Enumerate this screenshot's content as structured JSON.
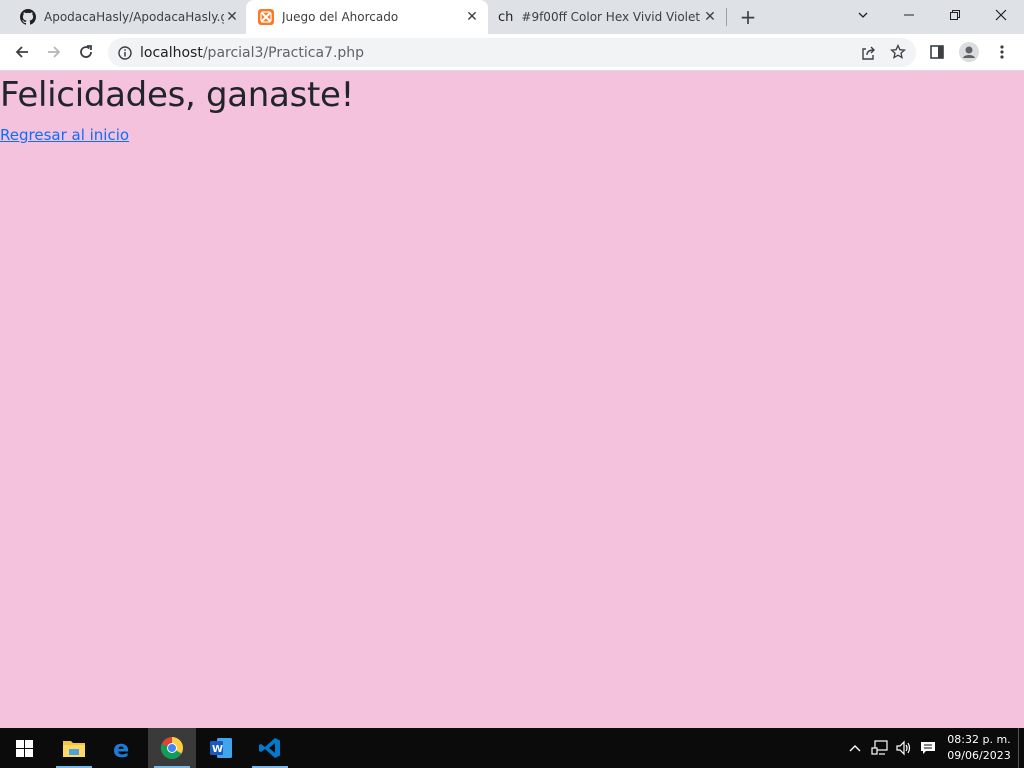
{
  "browser": {
    "tabs": [
      {
        "title": "ApodacaHasly/ApodacaHasly.git",
        "icon": "github-icon",
        "active": false
      },
      {
        "title": "Juego del Ahorcado",
        "icon": "xampp-icon",
        "active": true
      },
      {
        "title": "#9f00ff Color Hex Vivid Violet",
        "icon": "ch-icon",
        "favicon_text": "ch",
        "active": false
      }
    ],
    "address": {
      "host": "localhost",
      "path": "/parcial3/Practica7.php"
    }
  },
  "page": {
    "heading": "Felicidades, ganaste!",
    "link": "Regresar al inicio",
    "background_color": "#f4c2dc"
  },
  "taskbar": {
    "apps": [
      "windows-start-icon",
      "file-explorer-icon",
      "edge-icon",
      "chrome-icon",
      "word-icon",
      "vscode-icon"
    ],
    "clock": {
      "time": "08:32 p. m.",
      "date": "09/06/2023"
    }
  }
}
